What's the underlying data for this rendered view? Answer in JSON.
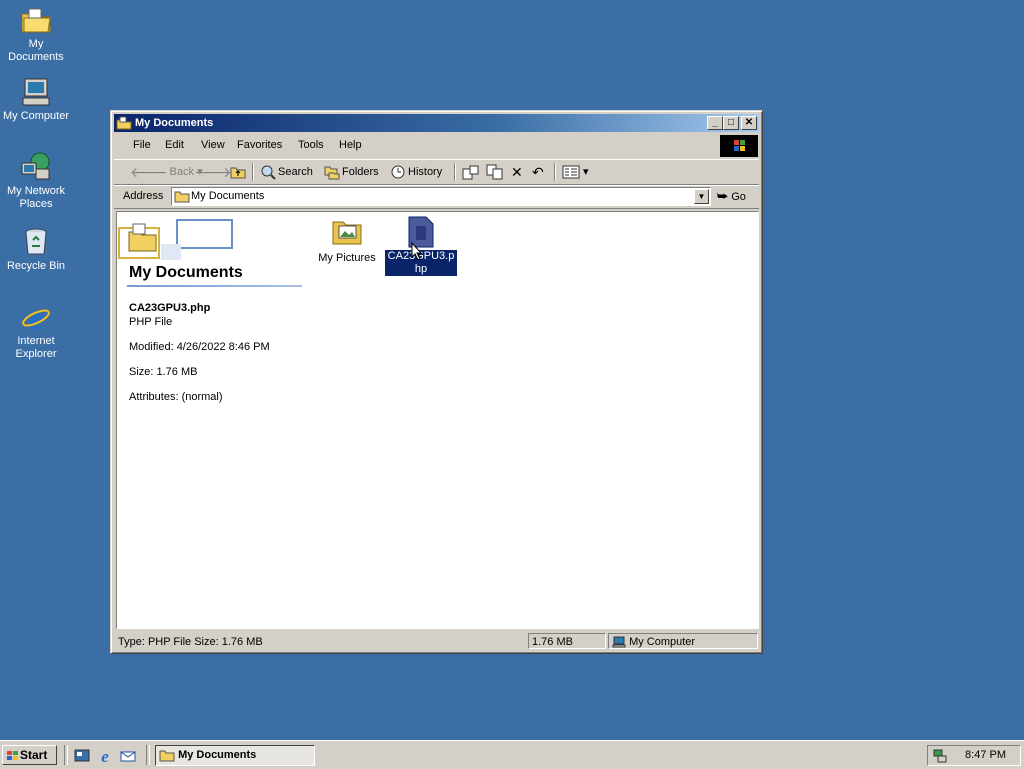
{
  "desktop": {
    "icons": [
      {
        "label": "My Documents"
      },
      {
        "label": "My Computer"
      },
      {
        "label": "My Network Places"
      },
      {
        "label": "Recycle Bin"
      },
      {
        "label": "Internet Explorer"
      }
    ]
  },
  "window": {
    "title": "My Documents",
    "menu": [
      "File",
      "Edit",
      "View",
      "Favorites",
      "Tools",
      "Help"
    ],
    "toolbar": {
      "back": "Back",
      "search": "Search",
      "folders": "Folders",
      "history": "History"
    },
    "address": {
      "label": "Address",
      "value": "My Documents",
      "go": "Go"
    },
    "webview": {
      "heading": "My Documents",
      "file_name": "CA23GPU3.php",
      "file_type": "PHP File",
      "modified": "Modified: 4/26/2022 8:46 PM",
      "size": "Size: 1.76 MB",
      "attributes": "Attributes: (normal)"
    },
    "items": [
      {
        "label": "My Pictures"
      },
      {
        "label": "CA23GPU3.php"
      }
    ],
    "status": {
      "info": "Type: PHP File Size: 1.76 MB",
      "size": "1.76 MB",
      "zone": "My Computer"
    }
  },
  "taskbar": {
    "start": "Start",
    "task": "My Documents",
    "clock": "8:47 PM"
  },
  "colors": {
    "desktop": "#3a6ea5",
    "title_active": "#0a246a",
    "selection": "#0a246a",
    "face": "#d4d0c8"
  }
}
